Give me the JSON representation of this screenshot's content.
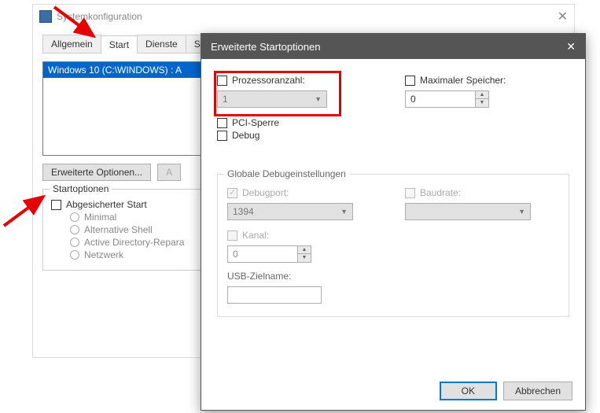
{
  "parent": {
    "title": "Systemkonfiguration",
    "tabs": [
      "Allgemein",
      "Start",
      "Dienste",
      "Start"
    ],
    "active_tab_index": 1,
    "os_entry": "Windows 10 (C:\\WINDOWS) : A",
    "advanced_btn": "Erweiterte Optionen...",
    "ghost_btn": "A",
    "startoptionen_label": "Startoptionen",
    "abgesicherter_start": "Abgesicherter Start",
    "radios": [
      "Minimal",
      "Alternative Shell",
      "Active Directory-Repara",
      "Netzwerk"
    ]
  },
  "dialog": {
    "title": "Erweiterte Startoptionen",
    "processor_count_label": "Prozessoranzahl:",
    "processor_count_value": "1",
    "max_memory_label": "Maximaler Speicher:",
    "max_memory_value": "0",
    "pci_lock": "PCI-Sperre",
    "debug": "Debug",
    "global_debug_label": "Globale Debugeinstellungen",
    "debugport_label": "Debugport:",
    "debugport_value": "1394",
    "baudrate_label": "Baudrate:",
    "kanal_label": "Kanal:",
    "kanal_value": "0",
    "usb_target_label": "USB-Zielname:",
    "ok": "OK",
    "cancel": "Abbrechen"
  }
}
